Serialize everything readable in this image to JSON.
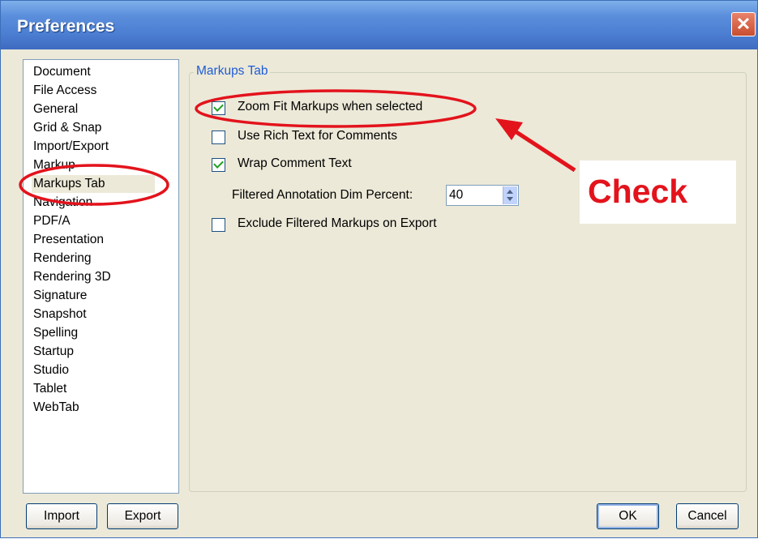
{
  "window": {
    "title": "Preferences",
    "close_glyph": "✕"
  },
  "sidebar": {
    "items": [
      {
        "label": "Document"
      },
      {
        "label": "File Access"
      },
      {
        "label": "General"
      },
      {
        "label": "Grid & Snap"
      },
      {
        "label": "Import/Export"
      },
      {
        "label": "Markup"
      },
      {
        "label": "Markups Tab",
        "selected": true
      },
      {
        "label": "Navigation"
      },
      {
        "label": "PDF/A"
      },
      {
        "label": "Presentation"
      },
      {
        "label": "Rendering"
      },
      {
        "label": "Rendering 3D"
      },
      {
        "label": "Signature"
      },
      {
        "label": "Snapshot"
      },
      {
        "label": "Spelling"
      },
      {
        "label": "Startup"
      },
      {
        "label": "Studio"
      },
      {
        "label": "Tablet"
      },
      {
        "label": "WebTab"
      }
    ]
  },
  "panel": {
    "group_label": "Markups Tab",
    "options": [
      {
        "label": "Zoom Fit Markups when selected",
        "checked": true
      },
      {
        "label": "Use Rich Text for Comments",
        "checked": false
      },
      {
        "label": "Wrap Comment Text",
        "checked": true
      },
      {
        "label": "Exclude Filtered Markups on Export",
        "checked": false
      }
    ],
    "dim_percent": {
      "label": "Filtered Annotation Dim Percent:",
      "value": "40"
    }
  },
  "buttons": {
    "import": "Import",
    "export": "Export",
    "ok": "OK",
    "cancel": "Cancel"
  },
  "annotation": {
    "callout_text": "Check",
    "color": "#e3131c"
  },
  "colors": {
    "titlebar": "#4b7dd1",
    "dialog_bg": "#ece9d8",
    "group_label": "#1f5bd6",
    "check": "#21a121"
  }
}
